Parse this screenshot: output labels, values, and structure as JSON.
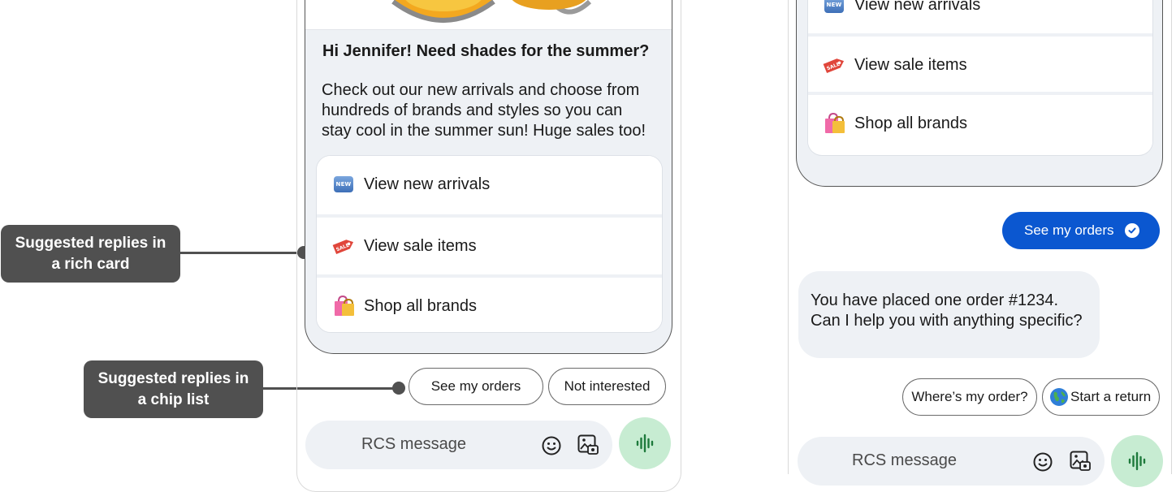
{
  "callouts": {
    "rich_card": "Suggested replies in a rich card",
    "chip_list": "Suggested replies in a chip list"
  },
  "left_phone": {
    "card": {
      "title": "Hi Jennifer! Need shades for the summer?",
      "description": "Check out our new arrivals and choose from hundreds of brands and styles so you can stay cool in the summer sun! Huge sales too!",
      "replies": [
        {
          "label": "View new arrivals",
          "icon": "new-badge-icon"
        },
        {
          "label": "View sale items",
          "icon": "sale-tag-icon"
        },
        {
          "label": "Shop all brands",
          "icon": "shopping-bags-icon"
        }
      ],
      "badge_text": "NEW",
      "tag_text": "SALE"
    },
    "chips": [
      "See my orders",
      "Not interested"
    ],
    "compose": {
      "placeholder": "RCS message"
    }
  },
  "right_phone": {
    "card": {
      "replies": [
        {
          "label": "View new arrivals",
          "icon": "new-badge-icon"
        },
        {
          "label": "View sale items",
          "icon": "sale-tag-icon"
        },
        {
          "label": "Shop all brands",
          "icon": "shopping-bags-icon"
        }
      ]
    },
    "sent_chip": "See my orders",
    "incoming_message": "You have placed one order #1234. Can I help you with anything specific?",
    "chips": [
      "Where’s my order?",
      "Start a return"
    ],
    "compose": {
      "placeholder": "RCS message"
    }
  },
  "colors": {
    "callout_bg": "#505050",
    "accent_blue": "#0b57d0",
    "card_bg": "#eef1f5",
    "mic_bg": "#c7ecd2",
    "mic_icon": "#1e7a3c"
  }
}
